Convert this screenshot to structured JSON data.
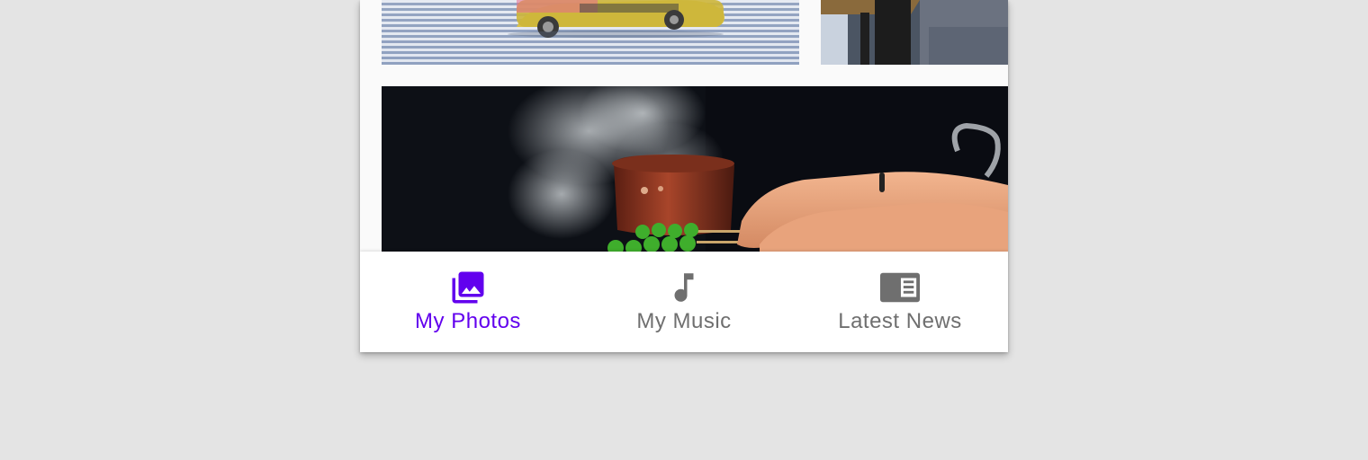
{
  "colors": {
    "active": "#6200ee",
    "inactive": "#6f6f6f",
    "page_background": "#e4e4e4",
    "surface": "#ffffff"
  },
  "photos": [
    {
      "name": "taxi-crosswalk-photo",
      "subject": "yellow taxi driving over crosswalk"
    },
    {
      "name": "street-bench-photo",
      "subject": "person sitting by a street"
    },
    {
      "name": "steaming-pot-photo",
      "subject": "hands cooking over a steaming copper pot"
    }
  ],
  "bottom_nav": {
    "items": [
      {
        "label": "My Photos",
        "icon": "photo-library-icon",
        "active": true
      },
      {
        "label": "My Music",
        "icon": "music-note-icon",
        "active": false
      },
      {
        "label": "Latest News",
        "icon": "newspaper-icon",
        "active": false
      }
    ]
  }
}
